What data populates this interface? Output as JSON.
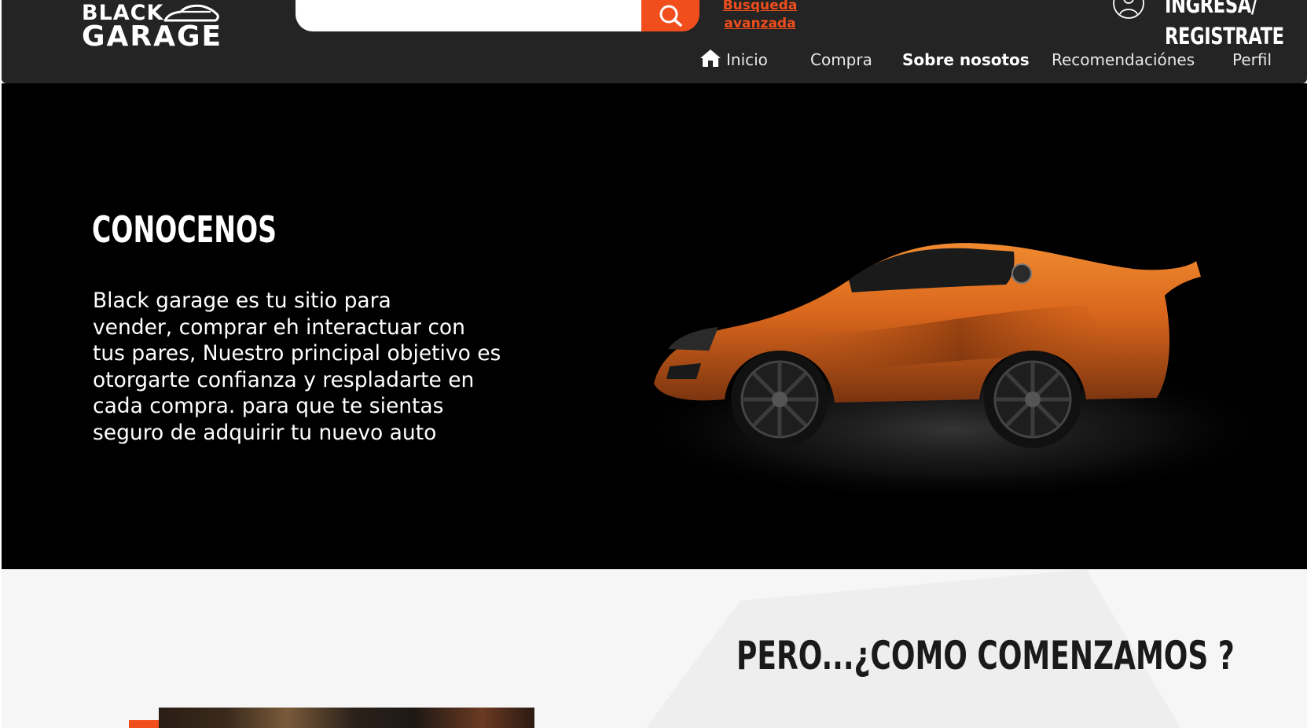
{
  "header": {
    "logo": {
      "line1": "BLACK",
      "line2": "GARAGE"
    },
    "search": {
      "value": "",
      "placeholder": "",
      "button_icon": "search-icon"
    },
    "advanced_search": {
      "line1": "Busqueda",
      "line2": "avanzada"
    },
    "account": {
      "icon": "user-icon",
      "line1": "INGRESA/",
      "line2": "REGISTRATE"
    },
    "nav": [
      {
        "label": "Inicio",
        "icon": "home-icon",
        "active": false
      },
      {
        "label": "Compra",
        "active": false
      },
      {
        "label": "Sobre nosotos",
        "active": true
      },
      {
        "label": "Recomendaciónes",
        "active": false
      },
      {
        "label": "Perfil",
        "active": false
      }
    ]
  },
  "hero": {
    "title": "CONOCENOS",
    "text_lines": [
      "Black garage es tu sitio para",
      "vender, comprar eh interactuar con",
      "tus pares, Nuestro principal objetivo es",
      "otorgarte confianza y respladarte en",
      "cada compra. para que te sientas",
      "seguro de adquirir tu nuevo auto"
    ]
  },
  "section2": {
    "title": "PERO...¿COMO COMENZAMOS ?"
  },
  "colors": {
    "accent": "#f04e1c",
    "header_bg": "#242424",
    "hero_bg": "#000000",
    "section_bg": "#f6f6f6",
    "car_orange": "#d9661c"
  }
}
